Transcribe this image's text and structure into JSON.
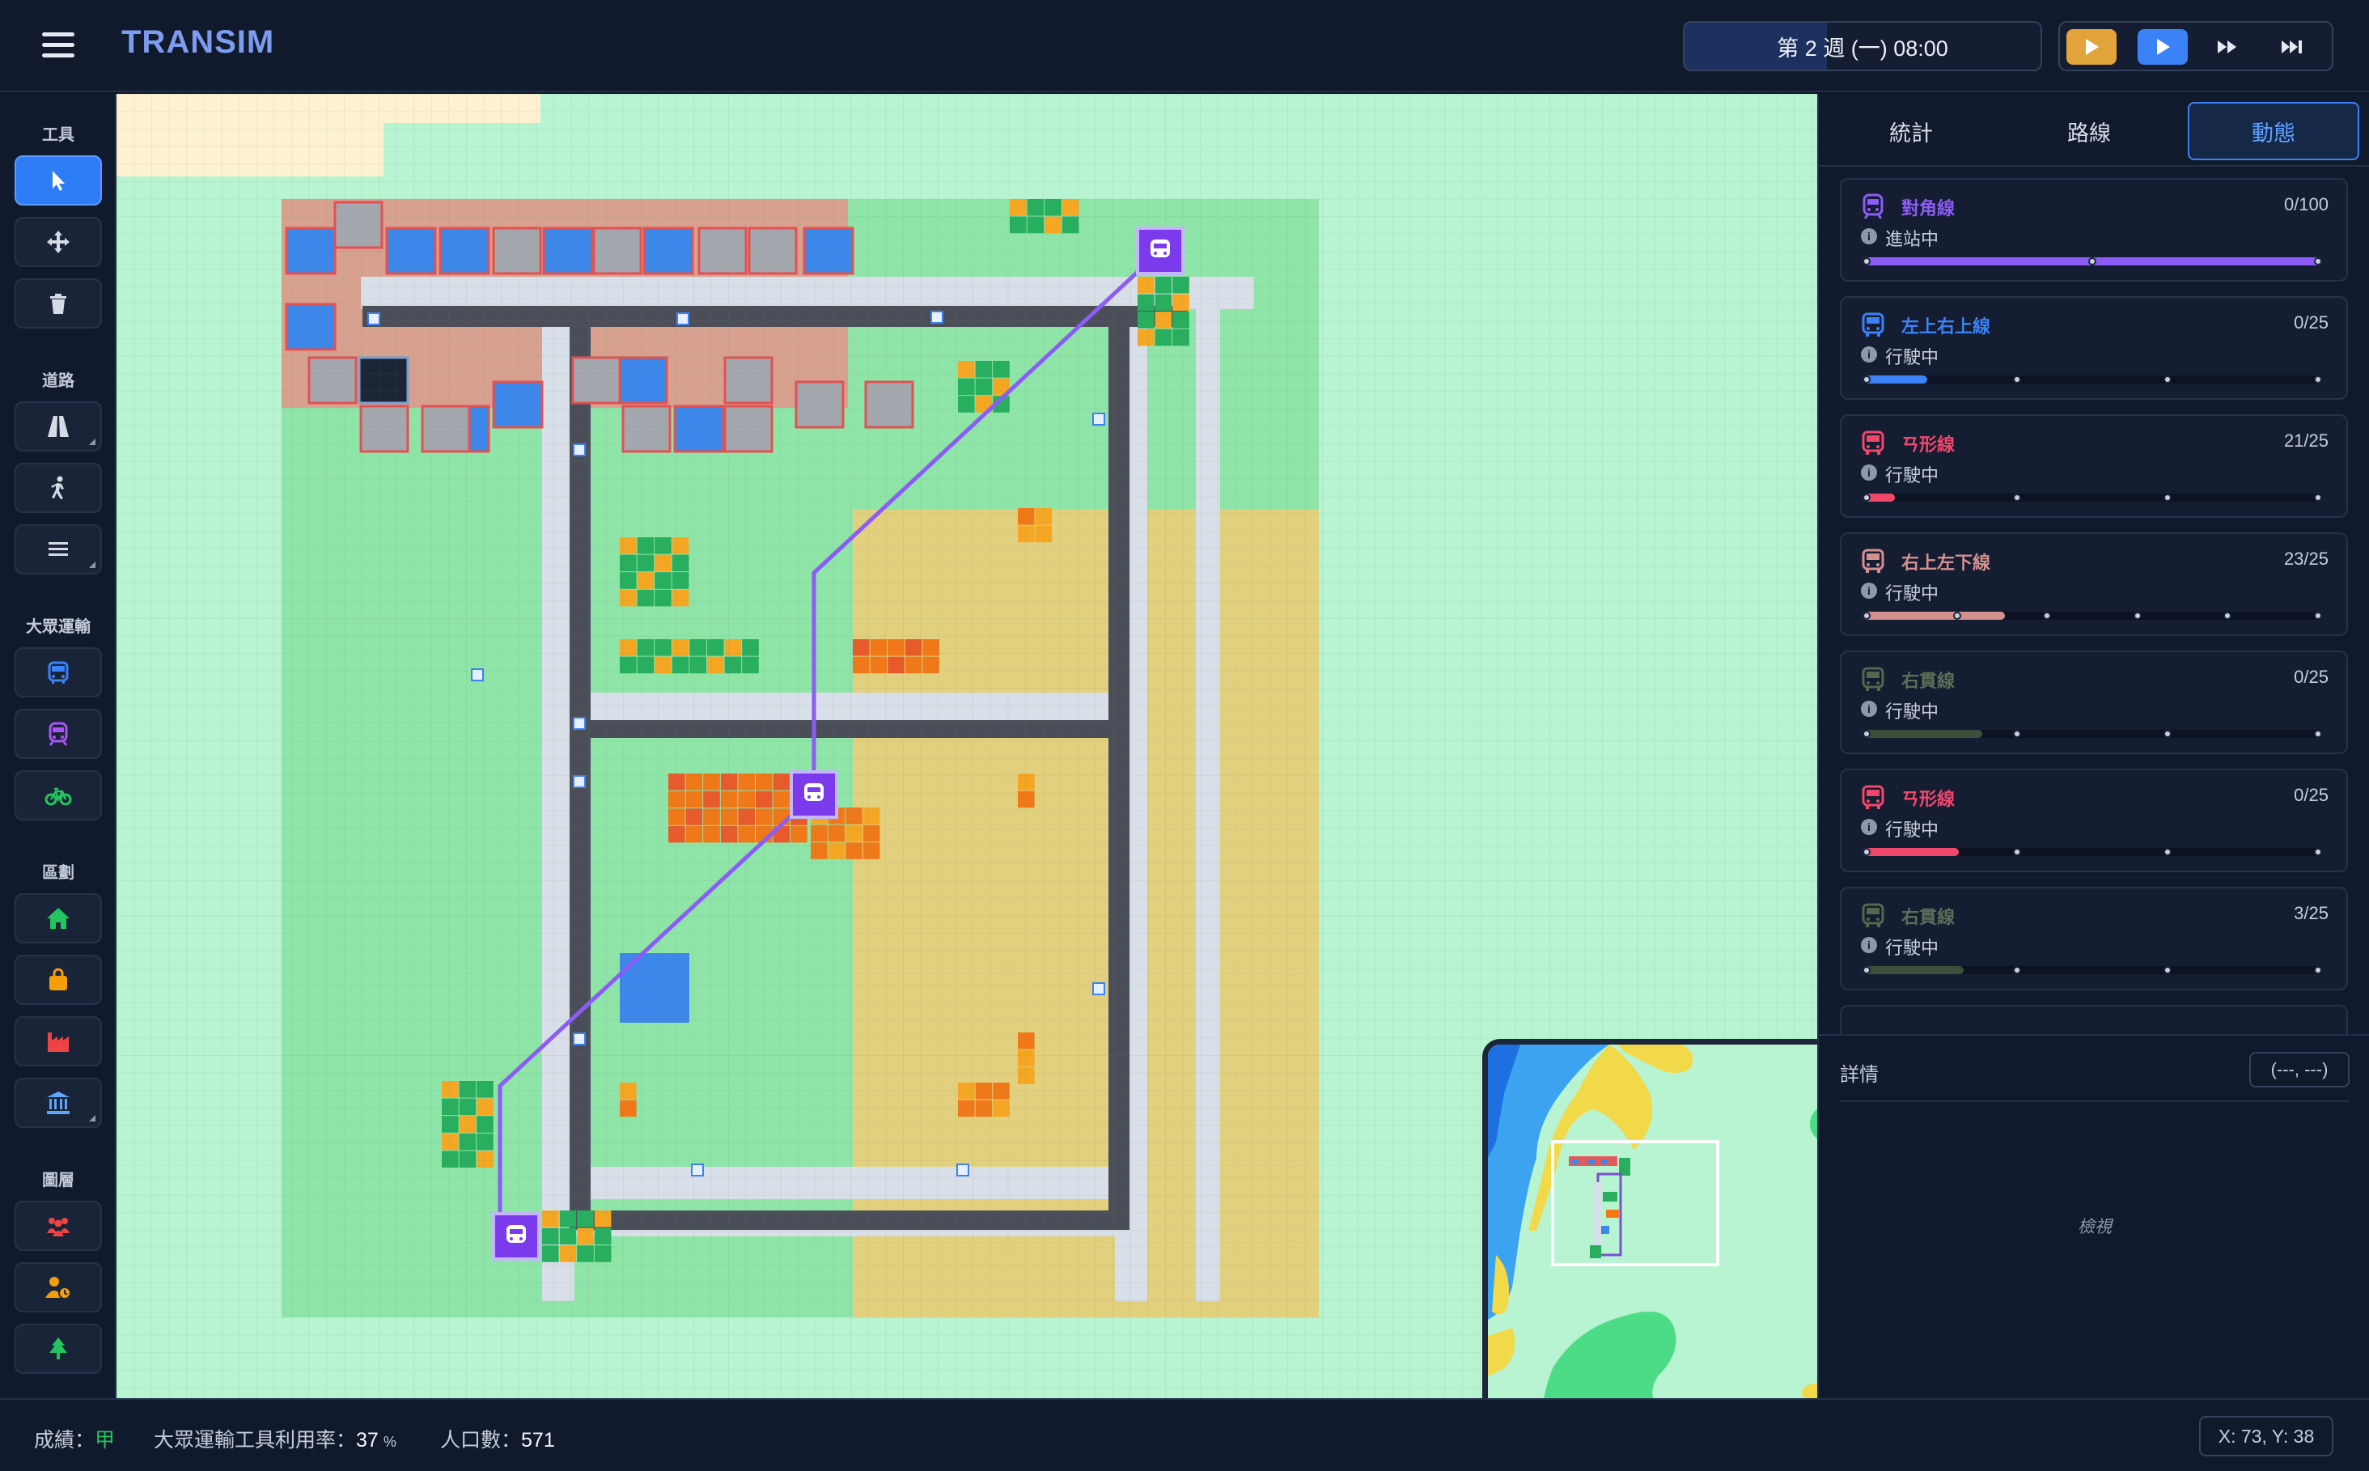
{
  "app": {
    "title": "TRANSIM"
  },
  "header": {
    "time": "第 2 週 (一) 08:00",
    "controls": [
      {
        "name": "pause",
        "icon": "play-icon",
        "color": "#e2a33a"
      },
      {
        "name": "play",
        "icon": "play-icon",
        "color": "#3b82f6"
      },
      {
        "name": "fast",
        "icon": "fast-forward-icon"
      },
      {
        "name": "fastest",
        "icon": "skip-forward-icon"
      }
    ]
  },
  "sidebar": {
    "sections": [
      {
        "label": "工具",
        "tools": [
          {
            "name": "select-tool",
            "icon": "cursor-icon",
            "active": true
          },
          {
            "name": "move-tool",
            "icon": "move-arrows-icon"
          },
          {
            "name": "delete-tool",
            "icon": "trash-icon"
          }
        ]
      },
      {
        "label": "道路",
        "tools": [
          {
            "name": "road-tool",
            "icon": "road-icon"
          },
          {
            "name": "walk-tool",
            "icon": "walking-icon"
          },
          {
            "name": "rail-tool",
            "icon": "rail-lines-icon"
          }
        ]
      },
      {
        "label": "大眾運輸",
        "tools": [
          {
            "name": "bus-tool",
            "icon": "bus-icon"
          },
          {
            "name": "train-tool",
            "icon": "train-icon"
          },
          {
            "name": "bike-tool",
            "icon": "bicycle-icon"
          }
        ]
      },
      {
        "label": "區劃",
        "tools": [
          {
            "name": "residential-zone-tool",
            "icon": "house-icon"
          },
          {
            "name": "commercial-zone-tool",
            "icon": "shopping-bag-icon"
          },
          {
            "name": "industrial-zone-tool",
            "icon": "factory-icon"
          },
          {
            "name": "civic-zone-tool",
            "icon": "bank-icon"
          }
        ]
      },
      {
        "label": "圖層",
        "tools": [
          {
            "name": "population-layer",
            "icon": "people-icon"
          },
          {
            "name": "commute-layer",
            "icon": "person-clock-icon"
          },
          {
            "name": "nature-layer",
            "icon": "tree-icon"
          }
        ]
      }
    ]
  },
  "tabs": [
    "統計",
    "路線",
    "動態"
  ],
  "active_tab": 2,
  "routes": [
    {
      "name": "對角線",
      "type": "train",
      "count": "0/100",
      "status": "進站中",
      "color": "#8b5cf6",
      "progress": 1.0,
      "stops": 3
    },
    {
      "name": "左上右上線",
      "type": "bus",
      "count": "0/25",
      "status": "行駛中",
      "color": "#3b82f6",
      "progress": 0.14,
      "stops": 4
    },
    {
      "name": "ㄢ形線",
      "type": "bus",
      "count": "21/25",
      "status": "行駛中",
      "color": "#f0476b",
      "progress": 0.07,
      "stops": 4
    },
    {
      "name": "右上左下線",
      "type": "bus",
      "count": "23/25",
      "status": "行駛中",
      "color": "#d4908e",
      "progress": 0.31,
      "stops": 6
    },
    {
      "name": "右貫線",
      "type": "bus",
      "count": "0/25",
      "status": "行駛中",
      "color": "#3b4f3a",
      "progress": 0.26,
      "stops": 4
    },
    {
      "name": "ㄢ形線",
      "type": "bus",
      "count": "0/25",
      "status": "行駛中",
      "color": "#f0476b",
      "progress": 0.21,
      "stops": 4
    },
    {
      "name": "右貫線",
      "type": "bus",
      "count": "3/25",
      "status": "行駛中",
      "color": "#3b4f3a",
      "progress": 0.22,
      "stops": 4
    }
  ],
  "details": {
    "title": "詳情",
    "coord": "(---, ---)",
    "hint": "檢視"
  },
  "footer": {
    "grade_label": "成績：",
    "grade": "甲",
    "utilization_label": "大眾運輸工具利用率：",
    "utilization": "37",
    "utilization_unit": "%",
    "population_label": "人口數：",
    "population": "571",
    "cursor": "X: 73, Y: 38"
  },
  "colors": {
    "grass": "#b8f4d2",
    "park": "#7ddc98",
    "sand": "#e3d07e",
    "road": "#d9dfe8",
    "rail": "#4b4e58",
    "residential": "#27ae5f",
    "commercial": "#f07818",
    "water": "#3d86ea",
    "station": "#8b5cf6"
  }
}
